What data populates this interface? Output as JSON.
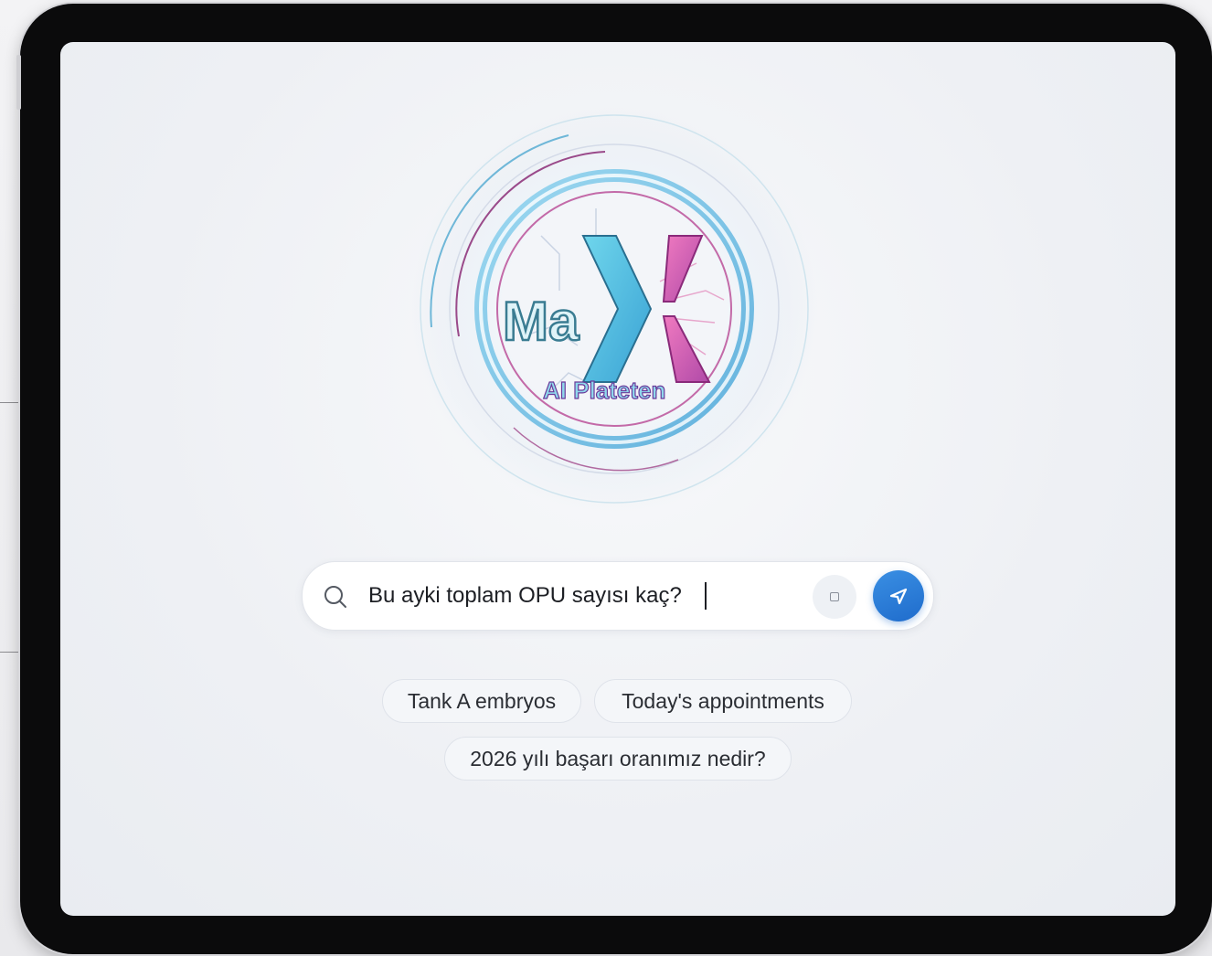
{
  "app": {
    "logo": {
      "wordmark_left": "Ma",
      "wordmark_right": "X",
      "tagline": "AI Plateten"
    }
  },
  "search": {
    "value": "Bu ayki toplam OPU sayısı kaç?",
    "icon": "search-icon",
    "attach_icon": "attach-icon",
    "send_icon": "send-icon"
  },
  "suggestions": [
    {
      "label": "Tank A embryos"
    },
    {
      "label": "Today's appointments"
    },
    {
      "label": "2026 yılı başarı oranımız nedir?"
    }
  ],
  "colors": {
    "accent": "#2a7fdc",
    "logo_cyan": "#5ec8e8",
    "logo_magenta": "#e85aa8",
    "logo_purple": "#7a5ab8"
  }
}
